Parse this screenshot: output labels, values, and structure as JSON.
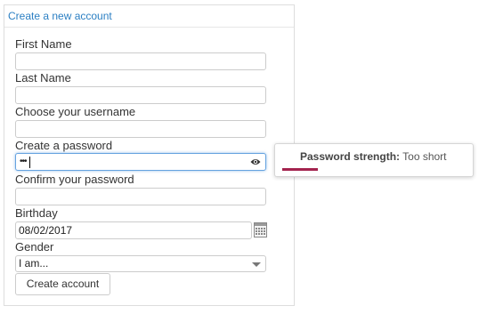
{
  "form": {
    "heading": "Create a new account",
    "first_name_label": "First Name",
    "first_name_value": "",
    "last_name_label": "Last Name",
    "last_name_value": "",
    "username_label": "Choose your username",
    "username_value": "",
    "password_label": "Create a password",
    "password_mask": "•••",
    "confirm_label": "Confirm your password",
    "confirm_value": "",
    "birthday_label": "Birthday",
    "birthday_value": "08/02/2017",
    "gender_label": "Gender",
    "gender_value": "I am...",
    "submit_label": "Create account"
  },
  "password_tooltip": {
    "title": "Password strength:",
    "value": "Too short",
    "bar_color": "#a3234e",
    "strength_fraction": 0.2
  },
  "icons": {
    "password_toggle": "eye-icon",
    "date_picker": "calendar-icon",
    "select_toggle": "chevron-down-icon"
  },
  "colors": {
    "heading": "#2b7fc3",
    "focus_border": "#66a3e0"
  }
}
